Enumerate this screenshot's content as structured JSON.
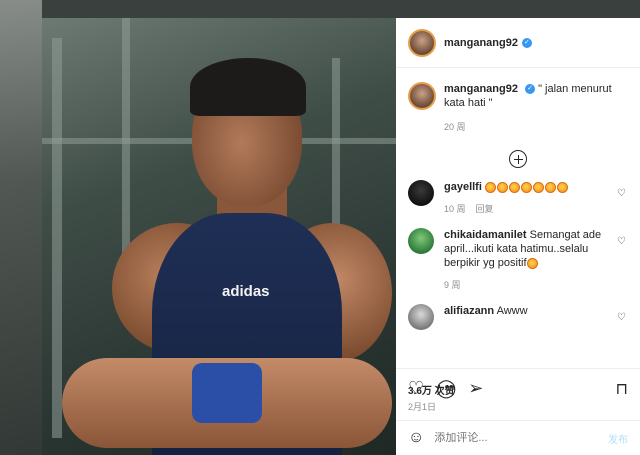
{
  "post": {
    "username": "manganang92",
    "photo_logo": "adidas",
    "caption": "\" jalan menurut kata hati \"",
    "caption_age": "20 周"
  },
  "comments": [
    {
      "username": "gayellfi",
      "text": "",
      "emoji_count": 7,
      "age": "10 周",
      "reply": "回复"
    },
    {
      "username": "chikaidamanilet",
      "text": "Semangat ade april...ikuti kata hatimu..selalu berpikir yg positif",
      "age": "9 周",
      "reply": ""
    },
    {
      "username": "alifiazann",
      "text": "Awww",
      "age": "",
      "reply": ""
    }
  ],
  "stats": {
    "likes": "3.6万 次赞",
    "date": "2月1日"
  },
  "add_comment": {
    "placeholder": "添加评论...",
    "post_label": "发布"
  },
  "icons": [
    "heart-icon",
    "comment-icon",
    "share-icon",
    "bookmark-icon",
    "emoji-icon",
    "load-more-icon"
  ],
  "colors": {
    "verified": "#3897f0",
    "post_button": "#b2dffc"
  }
}
